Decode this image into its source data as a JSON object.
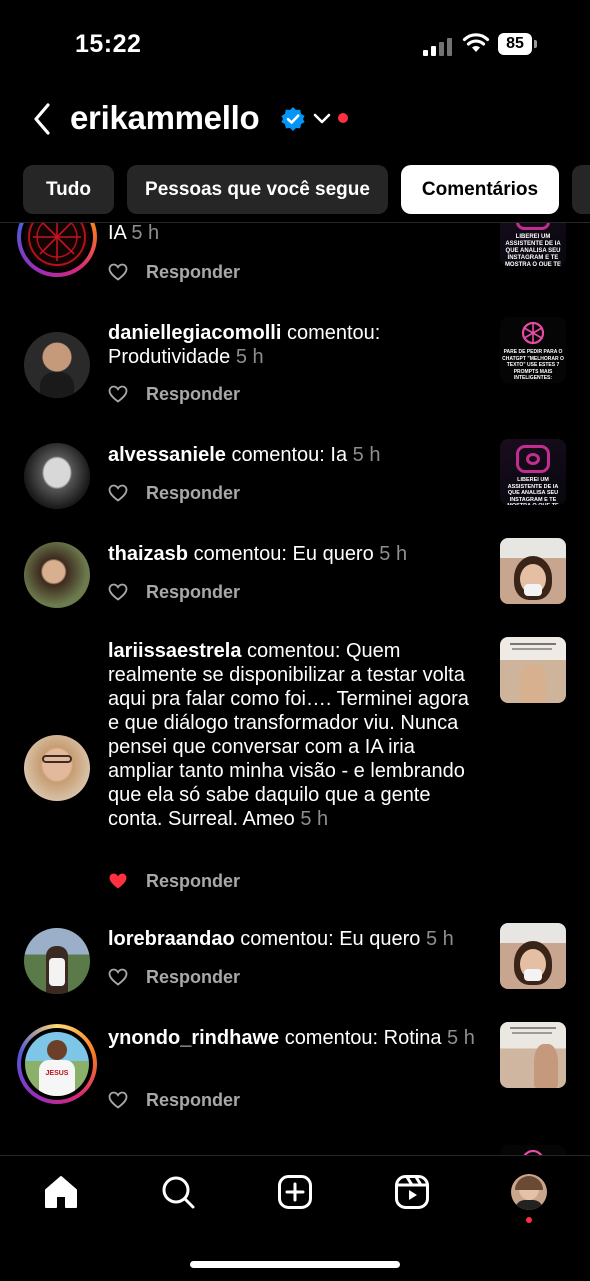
{
  "status": {
    "time": "15:22",
    "battery": "85"
  },
  "header": {
    "username": "erikammello"
  },
  "tabs": [
    {
      "label": "Tudo"
    },
    {
      "label": "Pessoas que você segue"
    },
    {
      "label": "Comentários"
    }
  ],
  "actions": {
    "reply": "Responder"
  },
  "items": [
    {
      "user": "",
      "verb": "",
      "comment": "IA",
      "time": "5 h",
      "liked": false
    },
    {
      "user": "daniellegiacomolli",
      "verb": "comentou:",
      "comment": "Produtividade",
      "time": "5 h",
      "liked": false
    },
    {
      "user": "alvessaniele",
      "verb": "comentou:",
      "comment": "Ia",
      "time": "5 h",
      "liked": false
    },
    {
      "user": "thaizasb",
      "verb": "comentou:",
      "comment": "Eu quero",
      "time": "5 h",
      "liked": false
    },
    {
      "user": "lariissaestrela",
      "verb": "comentou:",
      "comment": "Quem realmente se disponibilizar a testar volta aqui pra falar como foi…. Terminei agora e que diálogo transformador viu. Nunca pensei que conversar com a IA iria ampliar tanto minha visão - e lembrando que ela só sabe daquilo que a gente conta. Surreal. Ameo",
      "time": "5 h",
      "liked": true
    },
    {
      "user": "lorebraandao",
      "verb": "comentou:",
      "comment": "Eu quero",
      "time": "5 h",
      "liked": false
    },
    {
      "user": "ynondo_rindhawe",
      "verb": "comentou:",
      "comment": "Rotina",
      "time": "5 h",
      "liked": false
    }
  ],
  "thumbs": {
    "instagram_post_text": "LIBEREI UM ASSISTENTE DE IA QUE ANALISA SEU INSTAGRAM E TE MOSTRA O QUE TE TRAVA",
    "chatgpt_post_text": "PARE DE PEDIR PARA O CHATGPT \"MELHORAR O TEXTO\" USE ESTES 7 PROMPTS MAIS INTELIGENTES:",
    "avatar_badge_text": "JESUS"
  },
  "colors": {
    "accent_red": "#ff3040",
    "verified_blue": "#0095f6",
    "muted": "#8e8e8e",
    "tab_bg": "#262626"
  },
  "icons": [
    "home-icon",
    "search-icon",
    "create-icon",
    "reels-icon"
  ]
}
